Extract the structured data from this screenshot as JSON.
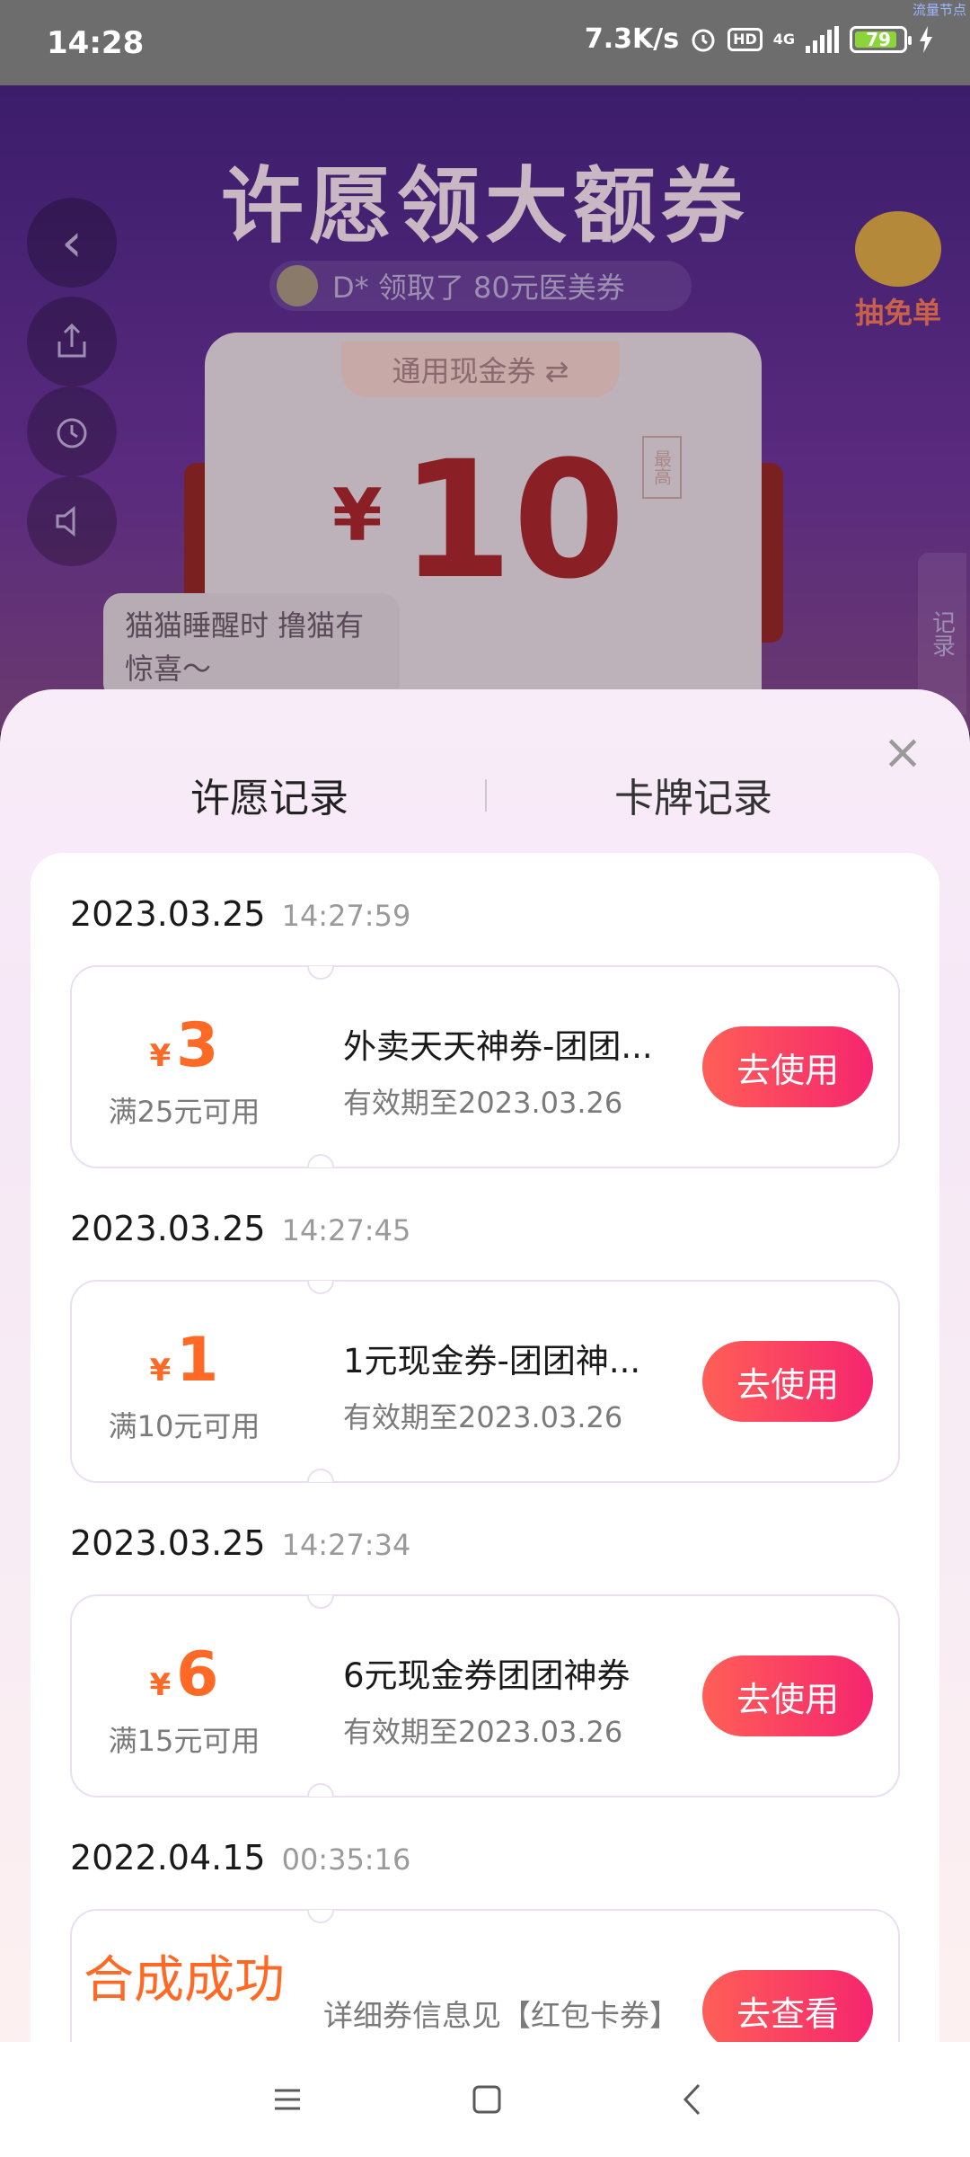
{
  "status_bar": {
    "time": "14:28",
    "speed": "7.3K/s",
    "hd": "HD",
    "network": "4G",
    "battery": "79",
    "corner_text": "流量节点"
  },
  "background": {
    "title": "许愿领大额券",
    "ticker": "D* 领取了 80元医美券",
    "free_label": "抽免单",
    "card_tab": "通用现金券 ⇄",
    "currency": "¥",
    "amount": "10",
    "max_label": "最高",
    "cat_text": "猫猫睡醒时 撸猫有惊喜〜",
    "record_side": "记录"
  },
  "sheet": {
    "tabs": [
      "许愿记录",
      "卡牌记录"
    ],
    "close": "×",
    "records": [
      {
        "date": "2023.03.25",
        "time": "14:27:59",
        "currency": "¥",
        "amount": "3",
        "condition": "满25元可用",
        "name": "外卖天天神券-团团...",
        "expiry": "有效期至2023.03.26",
        "button": "去使用"
      },
      {
        "date": "2023.03.25",
        "time": "14:27:45",
        "currency": "¥",
        "amount": "1",
        "condition": "满10元可用",
        "name": "1元现金券-团团神...",
        "expiry": "有效期至2023.03.26",
        "button": "去使用"
      },
      {
        "date": "2023.03.25",
        "time": "14:27:34",
        "currency": "¥",
        "amount": "6",
        "condition": "满15元可用",
        "name": "6元现金券团团神券",
        "expiry": "有效期至2023.03.26",
        "button": "去使用"
      },
      {
        "date": "2022.04.15",
        "time": "00:35:16",
        "synth": "合成成功",
        "info": "详细券信息见【红包卡券】",
        "button": "去查看"
      }
    ]
  },
  "colors": {
    "accent": "#fe6a26",
    "button_start": "#ff5f57",
    "button_end": "#f5256e"
  }
}
